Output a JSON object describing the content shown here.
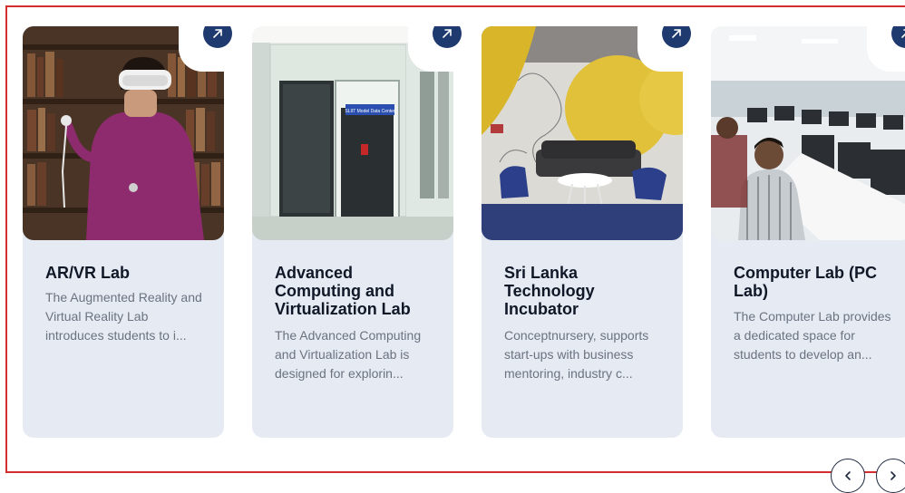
{
  "cards": [
    {
      "title": "AR/VR Lab",
      "description": "The Augmented Reality and Virtual Reality Lab introduces students to i...",
      "image": "vr-headset-student-photo"
    },
    {
      "title": "Advanced Computing and Virtualization Lab",
      "description": "The Advanced Computing and Virtualization Lab is designed for explorin...",
      "image": "data-center-glass-room-photo",
      "image_sign": "SLIIT Model Data Center"
    },
    {
      "title": "Sri Lanka Technology Incubator",
      "description": "Conceptnursery, supports start-ups with business mentoring, industry c...",
      "image": "incubator-lounge-photo"
    },
    {
      "title": "Computer Lab (PC Lab)",
      "description": "The Computer Lab provides a dedicated space for students to develop an...",
      "image": "computer-lab-students-photo"
    }
  ],
  "icons": {
    "open": "arrow-up-right-icon",
    "prev": "chevron-left-icon",
    "next": "chevron-right-icon"
  },
  "colors": {
    "card_bg": "#e6ebf3",
    "accent": "#1f3a6e",
    "frame_border": "#d32f2f",
    "title": "#101828",
    "body_text": "#6b7280"
  }
}
